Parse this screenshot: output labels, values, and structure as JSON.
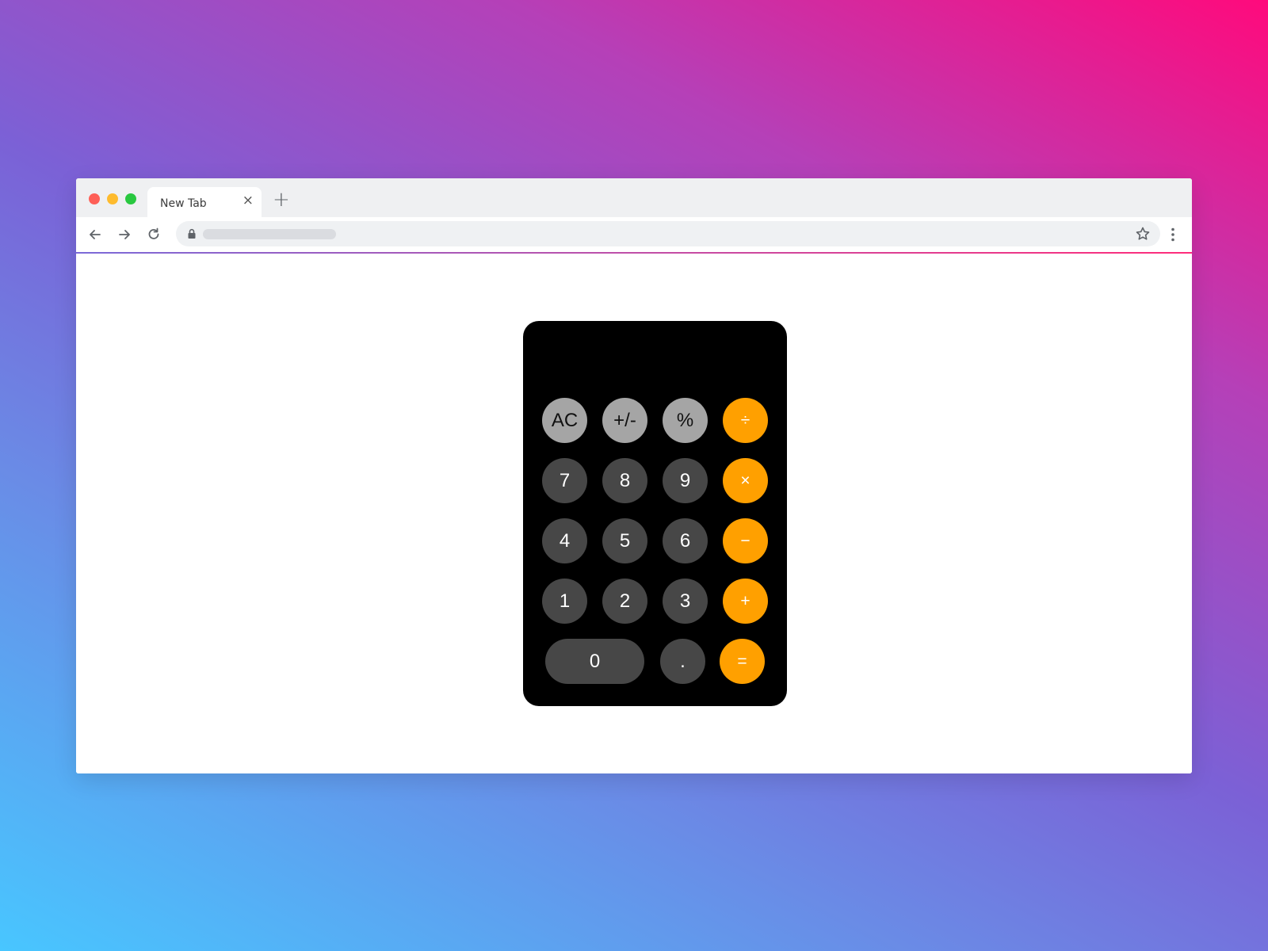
{
  "browser": {
    "tab_title": "New Tab",
    "tab_close_icon": "×",
    "new_tab_icon": "+",
    "nav_icons": [
      "back-arrow-icon",
      "forward-arrow-icon",
      "reload-icon"
    ],
    "url": "",
    "toolbar_icons": [
      "lock-icon",
      "star-icon",
      "more-vert-icon"
    ]
  },
  "calculator": {
    "display_value": "",
    "rows": [
      [
        {
          "label": "AC",
          "kind": "fn",
          "name": "clear-button"
        },
        {
          "label": "+/-",
          "kind": "fn",
          "name": "sign-toggle-button"
        },
        {
          "label": "%",
          "kind": "fn",
          "name": "percent-button"
        },
        {
          "label": "÷",
          "kind": "op",
          "name": "divide-button"
        }
      ],
      [
        {
          "label": "7",
          "kind": "num",
          "name": "digit-7-button"
        },
        {
          "label": "8",
          "kind": "num",
          "name": "digit-8-button"
        },
        {
          "label": "9",
          "kind": "num",
          "name": "digit-9-button"
        },
        {
          "label": "×",
          "kind": "op",
          "name": "multiply-button"
        }
      ],
      [
        {
          "label": "4",
          "kind": "num",
          "name": "digit-4-button"
        },
        {
          "label": "5",
          "kind": "num",
          "name": "digit-5-button"
        },
        {
          "label": "6",
          "kind": "num",
          "name": "digit-6-button"
        },
        {
          "label": "−",
          "kind": "op",
          "name": "subtract-button"
        }
      ],
      [
        {
          "label": "1",
          "kind": "num",
          "name": "digit-1-button"
        },
        {
          "label": "2",
          "kind": "num",
          "name": "digit-2-button"
        },
        {
          "label": "3",
          "kind": "num",
          "name": "digit-3-button"
        },
        {
          "label": "+",
          "kind": "op",
          "name": "add-button"
        }
      ],
      [
        {
          "label": "0",
          "kind": "num",
          "name": "digit-0-button"
        },
        {
          "label": ".",
          "kind": "num",
          "name": "decimal-button"
        },
        {
          "label": "=",
          "kind": "op",
          "name": "equals-button"
        }
      ]
    ]
  },
  "colors": {
    "function_key": "#a5a5a5",
    "number_key": "#474747",
    "operator_key": "#ffa000",
    "calculator_body": "#000000"
  }
}
